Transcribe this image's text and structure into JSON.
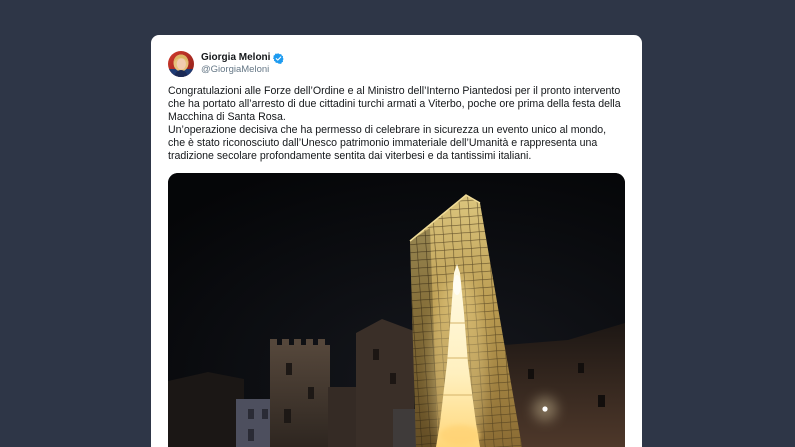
{
  "tweet": {
    "author": {
      "name": "Giorgia Meloni",
      "handle": "@GiorgiaMeloni",
      "verified": true,
      "avatar_icon": "profile-photo",
      "verified_icon": "verified-badge-icon"
    },
    "paragraphs": [
      [
        "Congratulazioni alle Forze dell’Ordine e al Ministro dell’Interno Piantedosi per il pronto intervento",
        "che ha portato all’arresto di due cittadini turchi armati a Viterbo, poche ore prima della festa della",
        "Macchina di Santa Rosa."
      ],
      [
        "Un’operazione decisiva che ha permesso di celebrare in sicurezza un evento unico al mondo,",
        "che è stato riconosciuto dall’Unesco patrimonio immateriale dell’Umanità e rappresenta una",
        "tradizione secolare profondamente sentita dai viterbesi e da tantissimi italiani."
      ]
    ],
    "media_icon": "night-photo-macchina-di-santa-rosa"
  },
  "colors": {
    "bg": "#2e3647",
    "card": "#ffffff",
    "text": "#14171a",
    "handle": "#657786",
    "verified": "#1d9bf0"
  }
}
